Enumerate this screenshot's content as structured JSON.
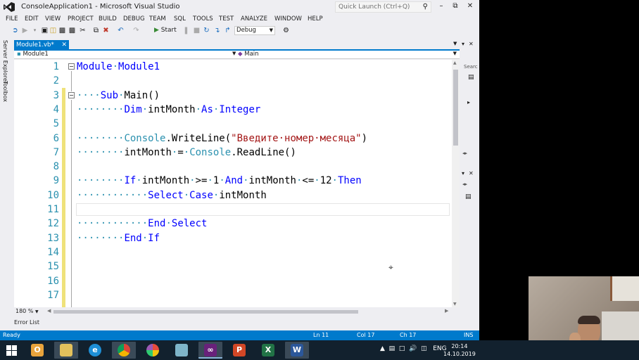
{
  "window": {
    "title": "ConsoleApplication1 - Microsoft Visual Studio",
    "quick_launch_placeholder": "Quick Launch (Ctrl+Q)"
  },
  "menu": [
    "FILE",
    "EDIT",
    "VIEW",
    "PROJECT",
    "BUILD",
    "DEBUG",
    "TEAM",
    "SQL",
    "TOOLS",
    "TEST",
    "ANALYZE",
    "WINDOW",
    "HELP"
  ],
  "toolbar": {
    "start_label": "Start",
    "config_value": "Debug"
  },
  "left_strip": {
    "server_explorer": "Server Explorer",
    "toolbox": "Toolbox"
  },
  "document": {
    "tab_label": "Module1.vb*",
    "nav_left": "Module1",
    "nav_right": "Main"
  },
  "editor": {
    "zoom": "180 %",
    "lines": [
      {
        "num": "1",
        "tokens": [
          {
            "t": "Module",
            "c": "kw"
          },
          {
            "t": "·",
            "c": "ws"
          },
          {
            "t": "Module1",
            "c": "kw"
          }
        ]
      },
      {
        "num": "2",
        "tokens": []
      },
      {
        "num": "3",
        "tokens": [
          {
            "t": "····",
            "c": "ws"
          },
          {
            "t": "Sub",
            "c": "kw"
          },
          {
            "t": "·",
            "c": "ws"
          },
          {
            "t": "Main()",
            "c": "pl"
          }
        ]
      },
      {
        "num": "4",
        "tokens": [
          {
            "t": "········",
            "c": "ws"
          },
          {
            "t": "Dim",
            "c": "kw"
          },
          {
            "t": "·",
            "c": "ws"
          },
          {
            "t": "intMonth",
            "c": "pl"
          },
          {
            "t": "·",
            "c": "ws"
          },
          {
            "t": "As",
            "c": "kw"
          },
          {
            "t": "·",
            "c": "ws"
          },
          {
            "t": "Integer",
            "c": "kw"
          }
        ]
      },
      {
        "num": "5",
        "tokens": []
      },
      {
        "num": "6",
        "tokens": [
          {
            "t": "········",
            "c": "ws"
          },
          {
            "t": "Console",
            "c": "ty"
          },
          {
            "t": ".WriteLine(",
            "c": "pl"
          },
          {
            "t": "\"Введите·номер·месяца\"",
            "c": "st"
          },
          {
            "t": ")",
            "c": "pl"
          }
        ]
      },
      {
        "num": "7",
        "tokens": [
          {
            "t": "········",
            "c": "ws"
          },
          {
            "t": "intMonth",
            "c": "pl"
          },
          {
            "t": "·",
            "c": "ws"
          },
          {
            "t": "=",
            "c": "pl"
          },
          {
            "t": "·",
            "c": "ws"
          },
          {
            "t": "Console",
            "c": "ty"
          },
          {
            "t": ".ReadLine()",
            "c": "pl"
          }
        ]
      },
      {
        "num": "8",
        "tokens": []
      },
      {
        "num": "9",
        "tokens": [
          {
            "t": "········",
            "c": "ws"
          },
          {
            "t": "If",
            "c": "kw"
          },
          {
            "t": "·",
            "c": "ws"
          },
          {
            "t": "intMonth",
            "c": "pl"
          },
          {
            "t": "·",
            "c": "ws"
          },
          {
            "t": ">=",
            "c": "pl"
          },
          {
            "t": "·",
            "c": "ws"
          },
          {
            "t": "1",
            "c": "pl"
          },
          {
            "t": "·",
            "c": "ws"
          },
          {
            "t": "And",
            "c": "kw"
          },
          {
            "t": "·",
            "c": "ws"
          },
          {
            "t": "intMonth",
            "c": "pl"
          },
          {
            "t": "·",
            "c": "ws"
          },
          {
            "t": "<=",
            "c": "pl"
          },
          {
            "t": "·",
            "c": "ws"
          },
          {
            "t": "12",
            "c": "pl"
          },
          {
            "t": "·",
            "c": "ws"
          },
          {
            "t": "Then",
            "c": "kw"
          }
        ]
      },
      {
        "num": "10",
        "tokens": [
          {
            "t": "············",
            "c": "ws"
          },
          {
            "t": "Select",
            "c": "kw"
          },
          {
            "t": "·",
            "c": "ws"
          },
          {
            "t": "Case",
            "c": "kw"
          },
          {
            "t": "·",
            "c": "ws"
          },
          {
            "t": "intMonth",
            "c": "pl"
          }
        ]
      },
      {
        "num": "11",
        "tokens": []
      },
      {
        "num": "12",
        "tokens": [
          {
            "t": "············",
            "c": "ws"
          },
          {
            "t": "End",
            "c": "kw"
          },
          {
            "t": "·",
            "c": "ws"
          },
          {
            "t": "Select",
            "c": "kw"
          }
        ]
      },
      {
        "num": "13",
        "tokens": [
          {
            "t": "········",
            "c": "ws"
          },
          {
            "t": "End",
            "c": "kw"
          },
          {
            "t": "·",
            "c": "ws"
          },
          {
            "t": "If",
            "c": "kw"
          }
        ]
      },
      {
        "num": "14",
        "tokens": []
      },
      {
        "num": "15",
        "tokens": []
      },
      {
        "num": "16",
        "tokens": []
      },
      {
        "num": "17",
        "tokens": []
      }
    ],
    "colors": {
      "kw": "#0000ff",
      "ty": "#2b91af",
      "st": "#a31515",
      "pl": "#000000",
      "ws": "#2b91af"
    }
  },
  "right_panel": {
    "search_label": "Searc"
  },
  "bottom_tabs": {
    "error_list": "Error List"
  },
  "status": {
    "ready": "Ready",
    "line": "Ln 11",
    "col": "Col 17",
    "ch": "Ch 17",
    "mode": "INS"
  },
  "taskbar": {
    "lang": "ENG",
    "time": "20:14",
    "date": "14.10.2019"
  }
}
